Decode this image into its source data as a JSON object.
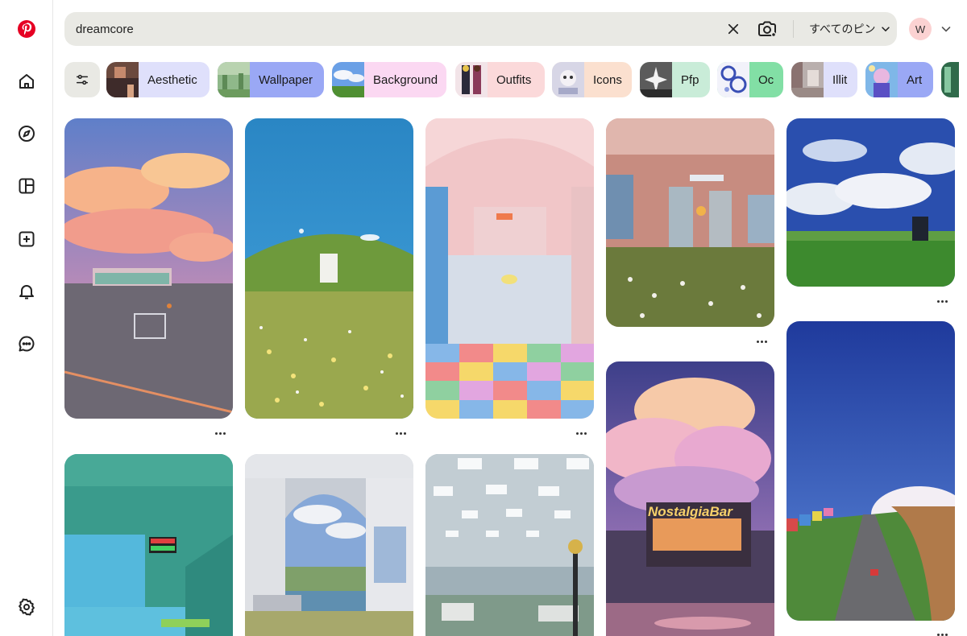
{
  "search": {
    "query": "dreamcore",
    "filter_label": "すべてのピン"
  },
  "account": {
    "initial": "W"
  },
  "chips": [
    {
      "label": "Aesthetic",
      "bg": "#dfe0fb"
    },
    {
      "label": "Wallpaper",
      "bg": "#9aa8f5"
    },
    {
      "label": "Background",
      "bg": "#fbd8f2"
    },
    {
      "label": "Outfits",
      "bg": "#fbd9da"
    },
    {
      "label": "Icons",
      "bg": "#fbe0cf"
    },
    {
      "label": "Pfp",
      "bg": "#c9ecd8"
    },
    {
      "label": "Oc",
      "bg": "#82dfa5"
    },
    {
      "label": "Illit",
      "bg": "#dfe0fb"
    },
    {
      "label": "Art",
      "bg": "#9aa8f5"
    }
  ],
  "colors": {
    "brand": "#e60023",
    "search_bg": "#e9e9e4",
    "avatar_bg": "#fbd2d2"
  },
  "icons": {
    "logo": "pinterest-logo",
    "home": "home-icon",
    "explore": "compass-icon",
    "boards": "boards-icon",
    "create": "plus-icon",
    "notifications": "bell-icon",
    "messages": "chat-icon",
    "settings": "gear-icon"
  }
}
